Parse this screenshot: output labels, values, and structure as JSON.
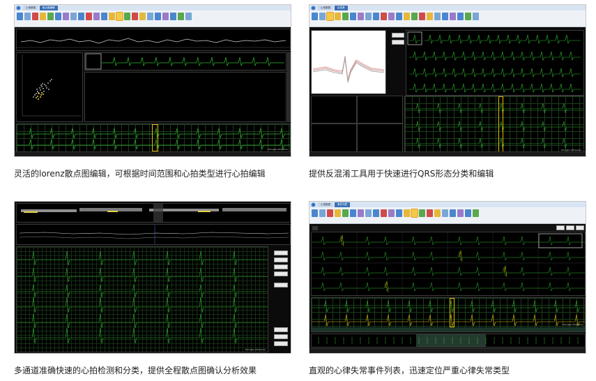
{
  "panels": [
    {
      "caption": "灵活的lorenz散点图编辑，可根据时间范围和心拍类型进行心拍编辑",
      "tabs": [
        "心电数据",
        "散点图编辑"
      ],
      "active_tab": 1,
      "status_right": "Zhongke Ultrawave"
    },
    {
      "caption": "提供反混淆工具用于快速进行QRS形态分类和编辑",
      "tabs": [
        "心电数据",
        "反混淆"
      ],
      "active_tab": 1,
      "status_right": "Zhongke Ultrawave"
    },
    {
      "caption": "多通道准确快速的心拍检测和分类，提供全程散点图确认分析效果",
      "tabs": [],
      "active_tab": -1,
      "status_right": "Zhongke Ultrawave"
    },
    {
      "caption": "直观的心律失常事件列表，迅速定位严重心律失常类型",
      "tabs": [
        "心电数据",
        "事件列表"
      ],
      "active_tab": 1,
      "status_right": "Zhongke Ultrawave"
    }
  ],
  "colors": {
    "ecg_green": "#2fb82f",
    "ecg_yellow": "#e6c200",
    "scatter_white": "#d8d8d8",
    "scatter_yellow": "#e8d44a",
    "trend_white": "#cfcfcf",
    "button_gray": "#e9e9e9",
    "tab_blue": "#3a6fb5"
  }
}
